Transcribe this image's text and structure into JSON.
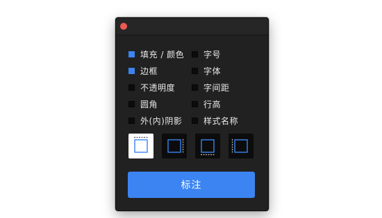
{
  "window": {
    "close_color": "#ee5a52"
  },
  "options": {
    "left": [
      {
        "label": "填充 / 颜色",
        "checked": true
      },
      {
        "label": "边框",
        "checked": true
      },
      {
        "label": "不透明度",
        "checked": false
      },
      {
        "label": "圆角",
        "checked": false
      },
      {
        "label": "外(内)阴影",
        "checked": false
      }
    ],
    "right": [
      {
        "label": "字号",
        "checked": false
      },
      {
        "label": "字体",
        "checked": false
      },
      {
        "label": "字间距",
        "checked": false
      },
      {
        "label": "行高",
        "checked": false
      },
      {
        "label": "样式名称",
        "checked": false
      }
    ]
  },
  "styles": [
    {
      "name": "top-dashed-style",
      "selected": true
    },
    {
      "name": "right-dashed-style",
      "selected": false
    },
    {
      "name": "bottom-dashed-style",
      "selected": false
    },
    {
      "name": "left-dashed-style",
      "selected": false
    }
  ],
  "colors": {
    "accent": "#3b84f2",
    "panel_bg": "#212121"
  },
  "action": {
    "mark_label": "标注"
  }
}
